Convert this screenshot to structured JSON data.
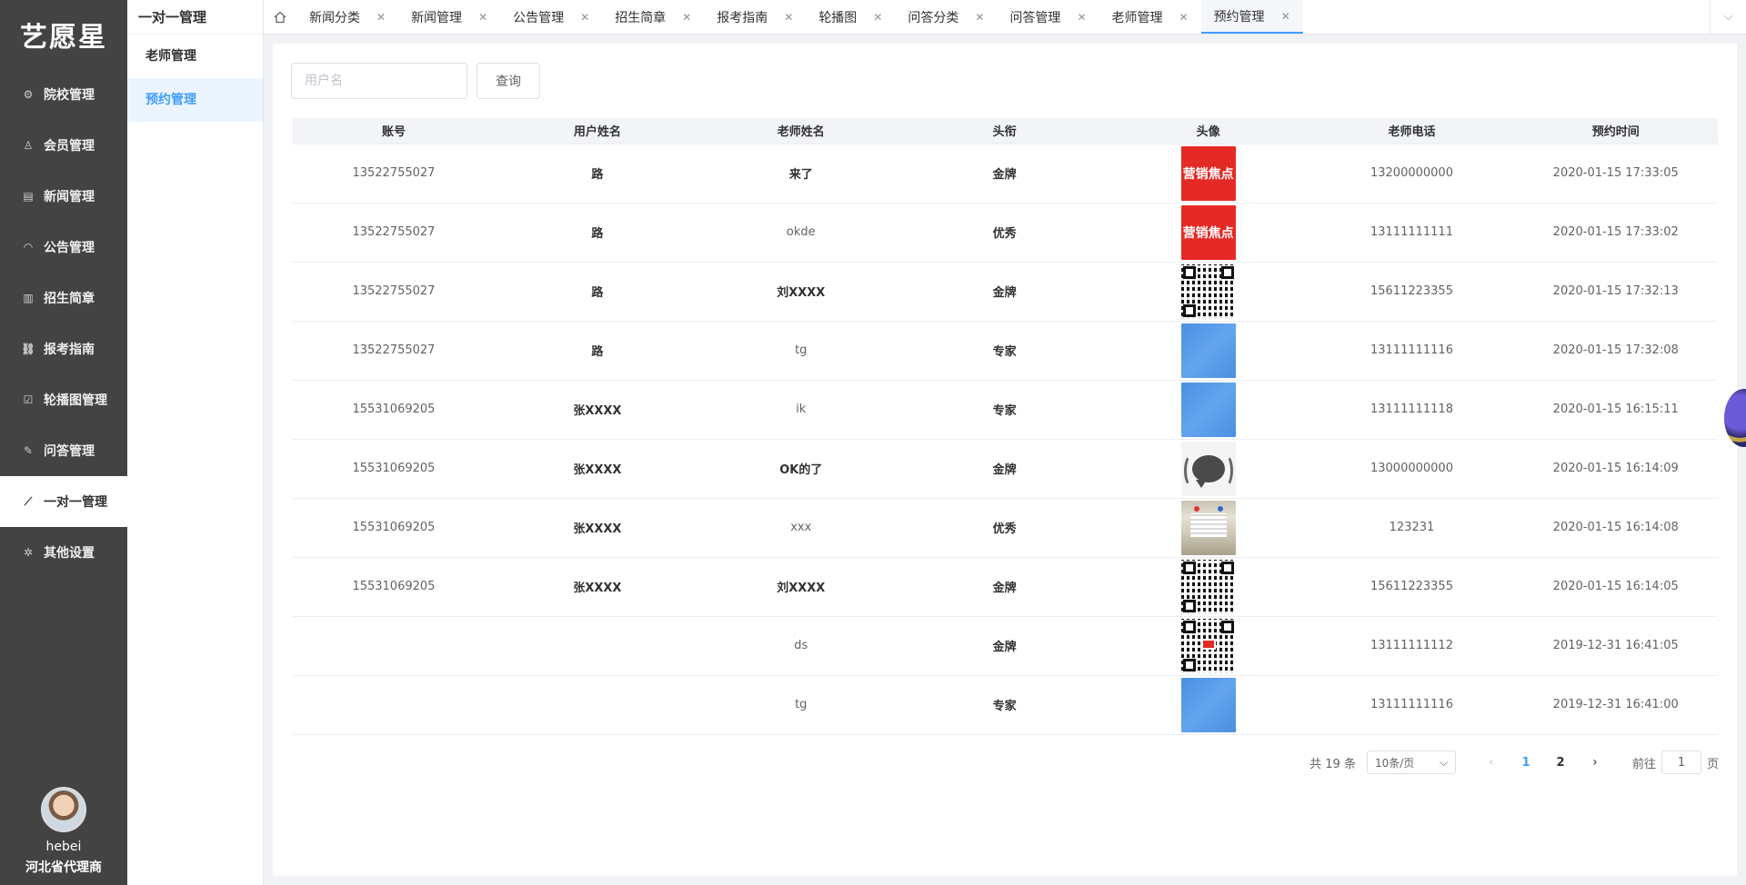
{
  "app": {
    "logo": "艺愿星"
  },
  "sidebar": {
    "items": [
      {
        "label": "院校管理",
        "icon": "gear-icon",
        "glyph": "⚙"
      },
      {
        "label": "会员管理",
        "icon": "shirt-icon",
        "glyph": "♙"
      },
      {
        "label": "新闻管理",
        "icon": "document-icon",
        "glyph": "▤"
      },
      {
        "label": "公告管理",
        "icon": "headset-icon",
        "glyph": "◠"
      },
      {
        "label": "招生简章",
        "icon": "file-icon",
        "glyph": "▥"
      },
      {
        "label": "报考指南",
        "icon": "link-icon",
        "glyph": "⛓"
      },
      {
        "label": "轮播图管理",
        "icon": "checkbox-icon",
        "glyph": "☑"
      },
      {
        "label": "问答管理",
        "icon": "edit-icon",
        "glyph": "✎"
      },
      {
        "label": "一对一管理",
        "icon": "wand-icon",
        "glyph": "⟋",
        "active": true
      },
      {
        "label": "其他设置",
        "icon": "settings-icon",
        "glyph": "✲"
      }
    ],
    "user": {
      "name": "hebei",
      "role": "河北省代理商"
    }
  },
  "subbar": {
    "title": "一对一管理",
    "items": [
      {
        "label": "老师管理"
      },
      {
        "label": "预约管理",
        "active": true
      }
    ]
  },
  "tabs": [
    {
      "label": "新闻分类"
    },
    {
      "label": "新闻管理"
    },
    {
      "label": "公告管理"
    },
    {
      "label": "招生简章"
    },
    {
      "label": "报考指南"
    },
    {
      "label": "轮播图"
    },
    {
      "label": "问答分类"
    },
    {
      "label": "问答管理"
    },
    {
      "label": "老师管理"
    },
    {
      "label": "预约管理",
      "active": true
    }
  ],
  "search": {
    "placeholder": "用户名",
    "value": "",
    "button": "查询"
  },
  "table": {
    "columns": [
      "账号",
      "用户姓名",
      "老师姓名",
      "头衔",
      "头像",
      "老师电话",
      "预约时间"
    ],
    "rows": [
      {
        "account": "13522755027",
        "user_name": "路",
        "teacher": "来了",
        "title": "金牌",
        "avatar": "red",
        "avatar_text": "营销焦点",
        "phone": "13200000000",
        "time": "2020-01-15 17:33:05"
      },
      {
        "account": "13522755027",
        "user_name": "路",
        "teacher": "okde",
        "title": "优秀",
        "avatar": "red",
        "avatar_text": "营销焦点",
        "phone": "13111111111",
        "time": "2020-01-15 17:33:02"
      },
      {
        "account": "13522755027",
        "user_name": "路",
        "teacher": "刘XXXX",
        "title": "金牌",
        "avatar": "qr",
        "phone": "15611223355",
        "time": "2020-01-15 17:32:13"
      },
      {
        "account": "13522755027",
        "user_name": "路",
        "teacher": "tg",
        "title": "专家",
        "avatar": "blue",
        "phone": "13111111116",
        "time": "2020-01-15 17:32:08"
      },
      {
        "account": "15531069205",
        "user_name": "张XXXX",
        "teacher": "ik",
        "title": "专家",
        "avatar": "blue",
        "phone": "13111111118",
        "time": "2020-01-15 16:15:11"
      },
      {
        "account": "15531069205",
        "user_name": "张XXXX",
        "teacher": "OK的了",
        "title": "金牌",
        "avatar": "gray",
        "phone": "13000000000",
        "time": "2020-01-15 16:14:09"
      },
      {
        "account": "15531069205",
        "user_name": "张XXXX",
        "teacher": "xxx",
        "title": "优秀",
        "avatar": "photo",
        "phone": "123231",
        "time": "2020-01-15 16:14:08"
      },
      {
        "account": "15531069205",
        "user_name": "张XXXX",
        "teacher": "刘XXXX",
        "title": "金牌",
        "avatar": "qr",
        "phone": "15611223355",
        "time": "2020-01-15 16:14:05"
      },
      {
        "account": "",
        "user_name": "",
        "teacher": "ds",
        "title": "金牌",
        "avatar": "qr-red",
        "phone": "13111111112",
        "time": "2019-12-31 16:41:05"
      },
      {
        "account": "",
        "user_name": "",
        "teacher": "tg",
        "title": "专家",
        "avatar": "blue",
        "phone": "13111111116",
        "time": "2019-12-31 16:41:00"
      }
    ]
  },
  "pagination": {
    "total_text": "共 19 条",
    "page_size": "10条/页",
    "pages": [
      "1",
      "2"
    ],
    "current": "1",
    "goto_label": "前往",
    "goto_value": "1",
    "goto_suffix": "页"
  }
}
